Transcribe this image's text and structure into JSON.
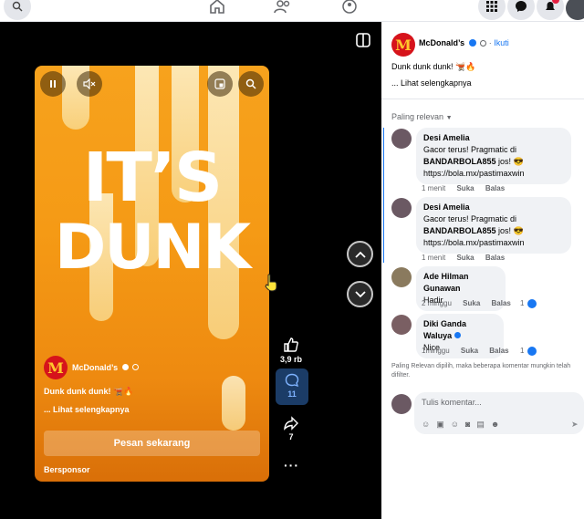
{
  "reel": {
    "headline_1": "IT’S",
    "headline_2": "DUNK",
    "page_name": "McDonald’s",
    "caption": "Dunk dunk dunk! 🫕🔥",
    "see_more": "... Lihat selengkapnya",
    "cta": "Pesan sekarang",
    "sponsored": "Bersponsor"
  },
  "side_actions": {
    "likes": "3,9 rb",
    "comments": "11",
    "shares": "7"
  },
  "post": {
    "page_name": "McDonald’s",
    "follow": "Ikuti",
    "caption": "Dunk dunk dunk! 🫕🔥",
    "see_more": "... Lihat selengkapnya",
    "sort": "Paling relevan"
  },
  "comments": [
    {
      "name": "Desi Amelia",
      "line1": "Gacor terus! Pragmatic di",
      "line2": "BANDARBOLA855",
      "line2b": " jos! 😎",
      "line3": "https://bola.mx/pastimaxwin",
      "time": "1 menit",
      "like": "Suka",
      "reply": "Balas",
      "reacts": ""
    },
    {
      "name": "Desi Amelia",
      "line1": "Gacor terus! Pragmatic di",
      "line2": "BANDARBOLA855",
      "line2b": " jos! 😎",
      "line3": "https://bola.mx/pastimaxwin",
      "time": "1 menit",
      "like": "Suka",
      "reply": "Balas",
      "reacts": ""
    },
    {
      "name": "Ade Hilman Gunawan",
      "text": "Hadir",
      "time": "2 minggu",
      "like": "Suka",
      "reply": "Balas",
      "reacts": "1"
    },
    {
      "name": "Diki Ganda Waluya",
      "text": "Nice",
      "time": "1minggu",
      "like": "Suka",
      "reply": "Balas",
      "reacts": "1"
    }
  ],
  "filter_note": "Paling Relevan dipilih, maka beberapa komentar mungkin telah difilter.",
  "composer": {
    "placeholder": "Tulis komentar..."
  },
  "colors": {
    "fb_blue": "#1877f2",
    "mc_red": "#d6131b",
    "mc_yellow": "#ffc72c"
  }
}
